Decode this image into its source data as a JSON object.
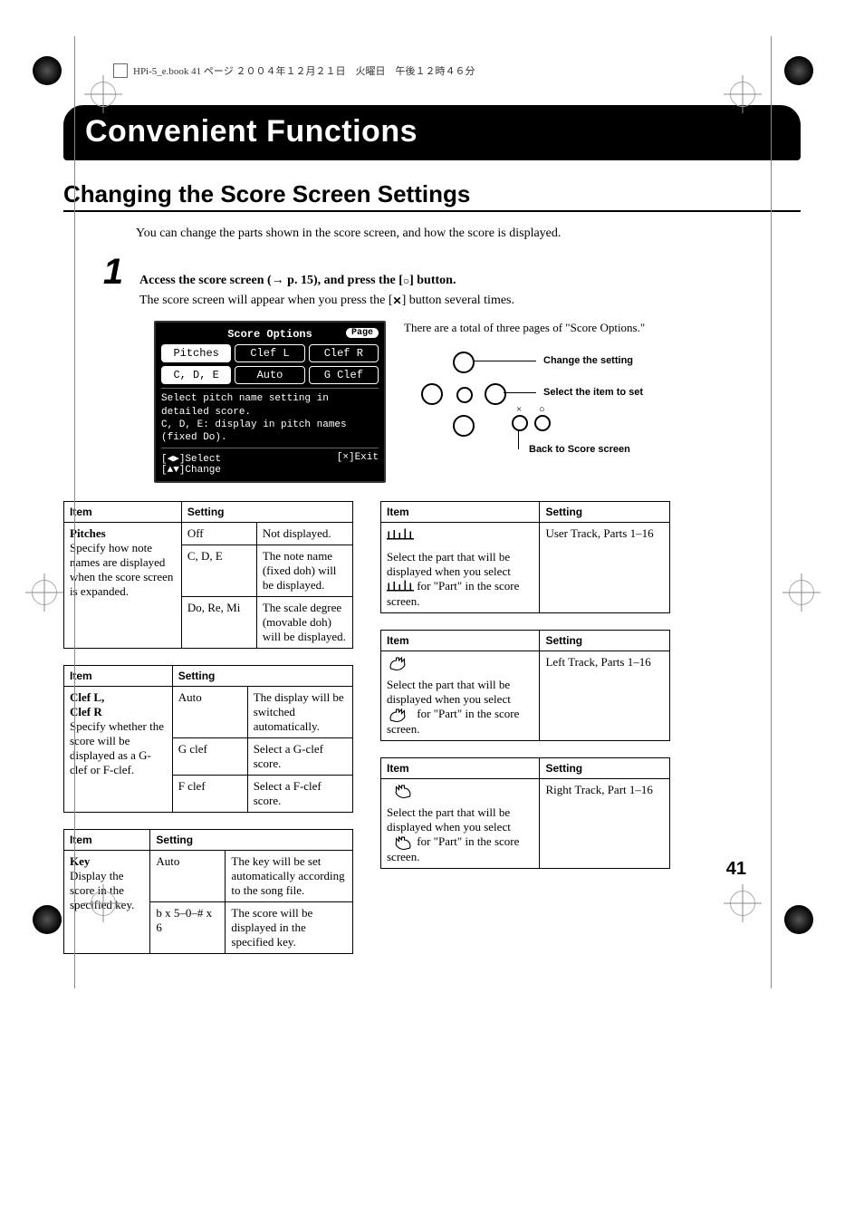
{
  "header": "HPi-5_e.book 41 ページ ２００４年１２月２１日　火曜日　午後１２時４６分",
  "chapter_title": "Convenient Functions",
  "section_title": "Changing the Score Screen Settings",
  "intro": "You can change the parts shown in the score screen, and how the score is displayed.",
  "step": {
    "num": "1",
    "text_a": "Access the score screen (",
    "text_arrow": "→",
    "text_b": " p. 15), and press the [",
    "text_c": "] button.",
    "sub_a": "The score screen will appear when you press the [",
    "sub_b": "] button several times."
  },
  "screenshot": {
    "title": "Score Options",
    "page_btn": "Page",
    "row1": [
      "Pitches",
      "Clef L",
      "Clef R"
    ],
    "row2": [
      "C, D, E",
      "Auto",
      "G Clef"
    ],
    "msg": "Select pitch name setting in detailed score.\nC, D, E: display in pitch names (fixed Do).",
    "foot_left": "[◀▶]Select\n[▲▼]Change",
    "foot_right": "[×]Exit"
  },
  "right_note": "There are a total of three pages of \"Score Options.\"",
  "nav_labels": {
    "change": "Change the setting",
    "select": "Select the item to set",
    "back": "Back to Score screen"
  },
  "page_number": "41",
  "th_item": "Item",
  "th_setting": "Setting",
  "tables_left": [
    {
      "item_title": "Pitches",
      "item_desc": "Specify how note names are displayed when the score screen is expanded.",
      "rows": [
        {
          "s": "Off",
          "d": "Not displayed."
        },
        {
          "s": "C, D, E",
          "d": "The note name (fixed doh) will be displayed."
        },
        {
          "s": "Do, Re, Mi",
          "d": "The scale degree (movable doh) will be displayed."
        }
      ]
    },
    {
      "item_title": "Clef L,\nClef R",
      "item_desc": "Specify whether the score will be displayed as a G-clef or F-clef.",
      "rows": [
        {
          "s": "Auto",
          "d": "The display will be switched automatically."
        },
        {
          "s": "G clef",
          "d": "Select a G-clef score."
        },
        {
          "s": "F clef",
          "d": "Select a F-clef score."
        }
      ]
    },
    {
      "item_title": "Key",
      "item_desc": "Display the score in the specified key.",
      "rows": [
        {
          "s": "Auto",
          "d": "The key will be set automatically according to the song file."
        },
        {
          "s": "b x 5–0–# x 6",
          "d": "The score will be displayed in the specified key."
        }
      ]
    }
  ],
  "tables_right": [
    {
      "icon": "music",
      "item_desc": "Select the part that will be displayed when you select ",
      "item_tail": " for \"Part\" in the score screen.",
      "setting": "User Track, Parts 1–16"
    },
    {
      "icon": "hand-left",
      "item_desc": "Select the part that will be displayed when you select ",
      "item_tail": " for \"Part\" in the score screen.",
      "setting": "Left Track, Parts 1–16"
    },
    {
      "icon": "hand-right",
      "item_desc": "Select the part that will be displayed when you select ",
      "item_tail": " for \"Part\" in the score screen.",
      "setting": "Right Track, Part 1–16"
    }
  ]
}
